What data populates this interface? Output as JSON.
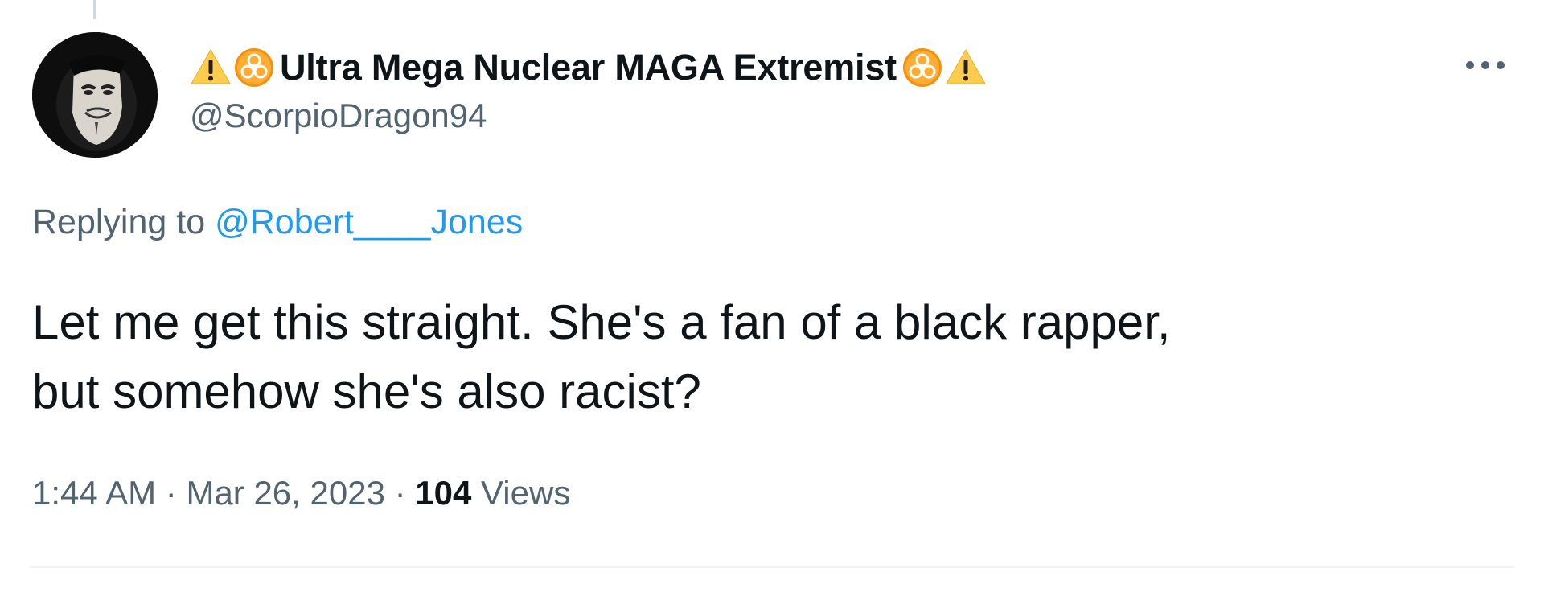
{
  "tweet": {
    "author": {
      "name_prefix_icons": [
        "warning-icon",
        "biohazard-icon"
      ],
      "display_name": "Ultra Mega Nuclear MAGA Extremist",
      "name_suffix_icons": [
        "biohazard-icon",
        "warning-icon"
      ],
      "handle": "@ScorpioDragon94",
      "avatar": "guy-fawkes-mask-avatar"
    },
    "more_options_icon": "more-horizontal-icon",
    "reply_context": {
      "prefix": "Replying to",
      "mention": "@Robert____Jones"
    },
    "text_lines": [
      "Let me get this straight. She's a fan of a black rapper,",
      "but somehow she's also racist?"
    ],
    "meta": {
      "time": "1:44 AM",
      "separator": "·",
      "date": "Mar 26, 2023",
      "views_count": "104",
      "views_label": "Views"
    }
  },
  "colors": {
    "text_primary": "#0f1419",
    "text_secondary": "#536471",
    "link": "#1d9bf0",
    "warning_yellow": "#ffcc4d",
    "biohazard_orange": "#f4900c",
    "divider": "#eff3f4"
  }
}
